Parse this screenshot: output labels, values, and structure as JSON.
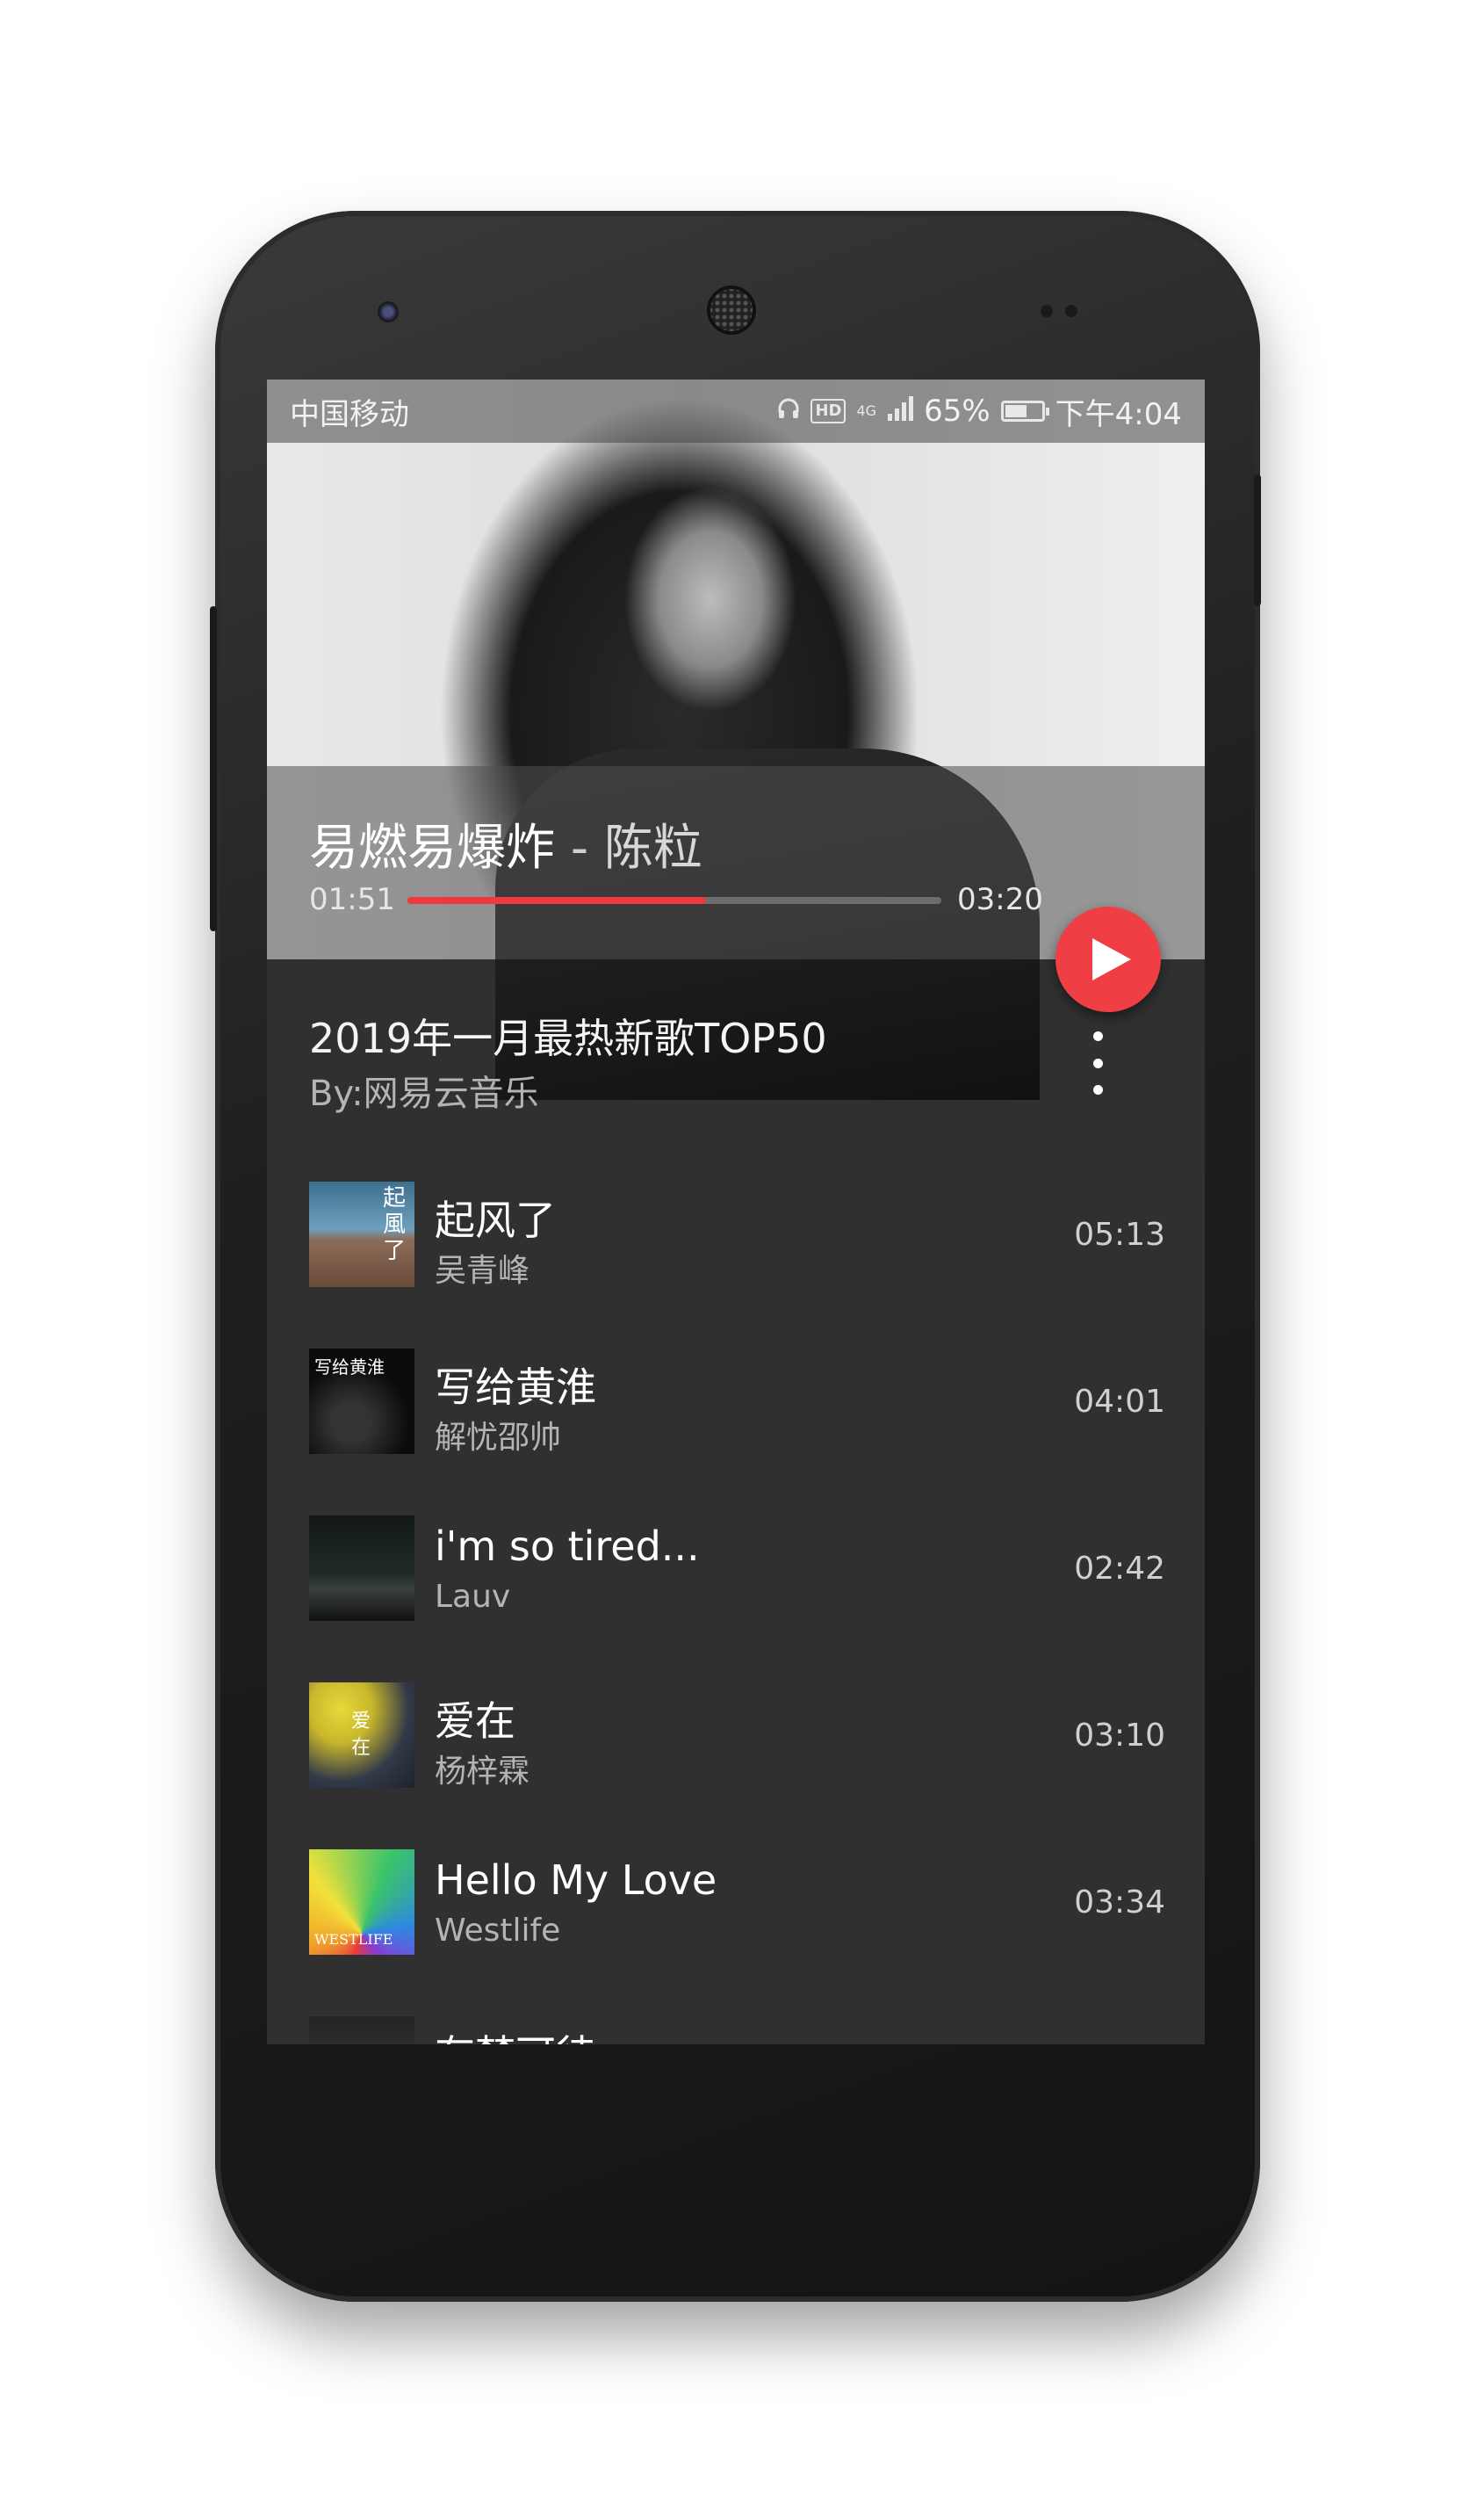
{
  "status_bar": {
    "carrier": "中国移动",
    "network": "4G",
    "hd": "HD",
    "battery_percent": "65%",
    "battery_level": 0.65,
    "time": "下午4:04"
  },
  "now_playing": {
    "song": "易燃易爆炸",
    "separator": "-",
    "artist": "陈粒",
    "current_time": "01:51",
    "total_time": "03:20",
    "progress": 0.56
  },
  "playlist": {
    "title": "2019年一月最热新歌TOP50",
    "by": "By:网易云音乐"
  },
  "tracks": [
    {
      "name": "起风了",
      "artist": "吴青峰",
      "duration": "05:13",
      "cover_text": "起風了"
    },
    {
      "name": "写给黄淮",
      "artist": "解忧邵帅",
      "duration": "04:01",
      "cover_text": "写给黄淮"
    },
    {
      "name": "i'm so tired...",
      "artist": "Lauv",
      "duration": "02:42",
      "cover_text": ""
    },
    {
      "name": "爱在",
      "artist": "杨梓霖",
      "duration": "03:10",
      "cover_text": "爱 在"
    },
    {
      "name": "Hello My Love",
      "artist": "Westlife",
      "duration": "03:34",
      "cover_text": "WESTLIFE"
    },
    {
      "name": "有梦可待",
      "artist": "",
      "duration": "",
      "cover_text": ""
    }
  ],
  "colors": {
    "accent": "#ef3f44",
    "background": "#303030",
    "secondary_text": "#b4b4b4"
  }
}
